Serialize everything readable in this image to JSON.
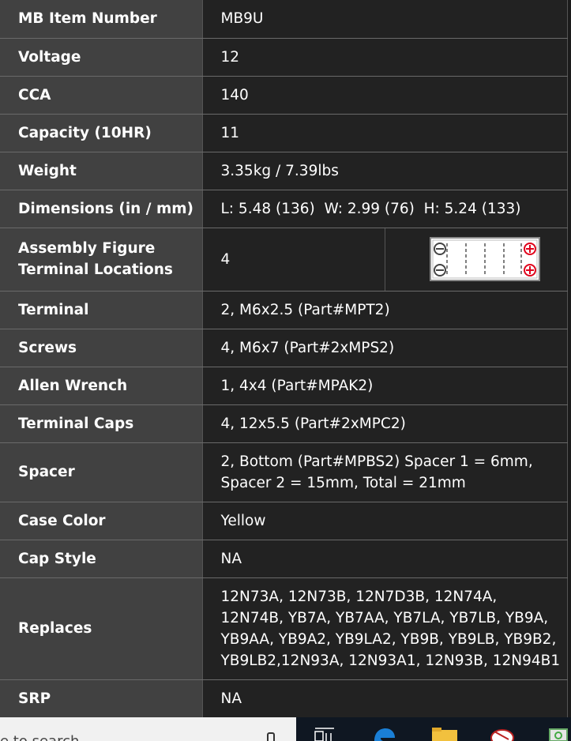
{
  "specs": {
    "item_number": {
      "label": "MB Item Number",
      "value": "MB9U"
    },
    "voltage": {
      "label": "Voltage",
      "value": "12"
    },
    "cca": {
      "label": "CCA",
      "value": "140"
    },
    "capacity": {
      "label": "Capacity (10HR)",
      "value": "11"
    },
    "weight": {
      "label": "Weight",
      "value": "3.35kg / 7.39lbs"
    },
    "dimensions": {
      "label": "Dimensions (in / mm)",
      "value": "L: 5.48 (136)  W: 2.99 (76)  H: 5.24 (133)"
    },
    "assembly": {
      "label_line1": "Assembly Figure",
      "label_line2": "Terminal Locations",
      "value": "4"
    },
    "terminal": {
      "label": "Terminal",
      "value": "2, M6x2.5 (Part#MPT2)"
    },
    "screws": {
      "label": "Screws",
      "value": "4, M6x7 (Part#2xMPS2)"
    },
    "allen_wrench": {
      "label": "Allen Wrench",
      "value": "1, 4x4 (Part#MPAK2)"
    },
    "terminal_caps": {
      "label": "Terminal Caps",
      "value": "4, 12x5.5 (Part#2xMPC2)"
    },
    "spacer": {
      "label": "Spacer",
      "line1": "2, Bottom (Part#MPBS2) Spacer 1 = 6mm,",
      "line2": "Spacer 2 = 15mm, Total = 21mm"
    },
    "case_color": {
      "label": "Case Color",
      "value": "Yellow"
    },
    "cap_style": {
      "label": "Cap Style",
      "value": "NA"
    },
    "replaces": {
      "label": "Replaces",
      "line1": "12N73A, 12N73B, 12N7D3B, 12N74A,",
      "line2": "12N74B, YB7A, YB7AA, YB7LA, YB7LB, YB9A,",
      "line3": "YB9AA, YB9A2, YB9LA2, YB9B, YB9LB, YB9B2,",
      "line4": "YB9LB2,12N93A, 12N93A1, 12N93B, 12N94B1"
    },
    "srp": {
      "label": "SRP",
      "value": "NA"
    }
  },
  "taskbar": {
    "search_text": "e to search",
    "icons": [
      "microphone-icon",
      "task-view-icon",
      "edge-browser-icon",
      "file-explorer-icon",
      "satellite-dish-icon",
      "app-icon"
    ]
  },
  "colors": {
    "label_bg": "#414141",
    "value_bg": "#222222",
    "negative_terminal": "#444444",
    "positive_terminal": "#e0001a"
  }
}
